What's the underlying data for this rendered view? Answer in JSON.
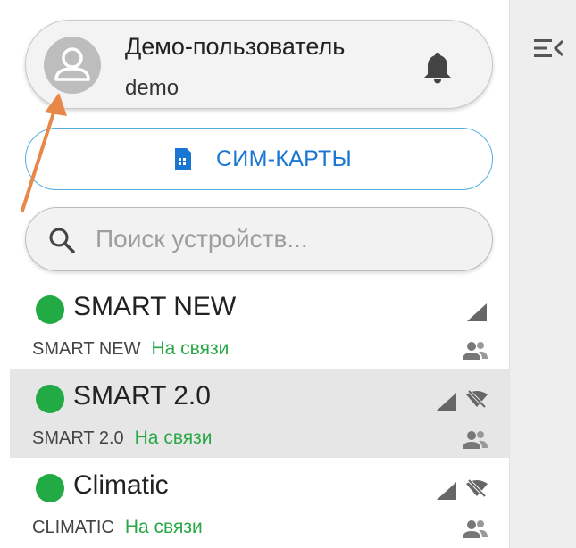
{
  "user": {
    "name": "Демо-пользователь",
    "login": "demo"
  },
  "sim_button": {
    "label": "СИМ-КАРТЫ"
  },
  "search": {
    "placeholder": "Поиск устройств..."
  },
  "devices": [
    {
      "name": "SMART NEW",
      "model": "SMART NEW",
      "status": "На связи",
      "selected": false,
      "icons": [
        "signal-icon",
        "users-icon"
      ]
    },
    {
      "name": "SMART 2.0",
      "model": "SMART 2.0",
      "status": "На связи",
      "selected": true,
      "icons": [
        "signal-icon",
        "wifi-off-icon",
        "users-icon"
      ]
    },
    {
      "name": "Climatic",
      "model": "CLIMATIC",
      "status": "На связи",
      "selected": false,
      "icons": [
        "signal-icon",
        "wifi-off-icon",
        "users-icon"
      ]
    }
  ],
  "colors": {
    "online": "#22aa44",
    "accent": "#1976d2",
    "annotation_arrow": "#e8874a"
  }
}
